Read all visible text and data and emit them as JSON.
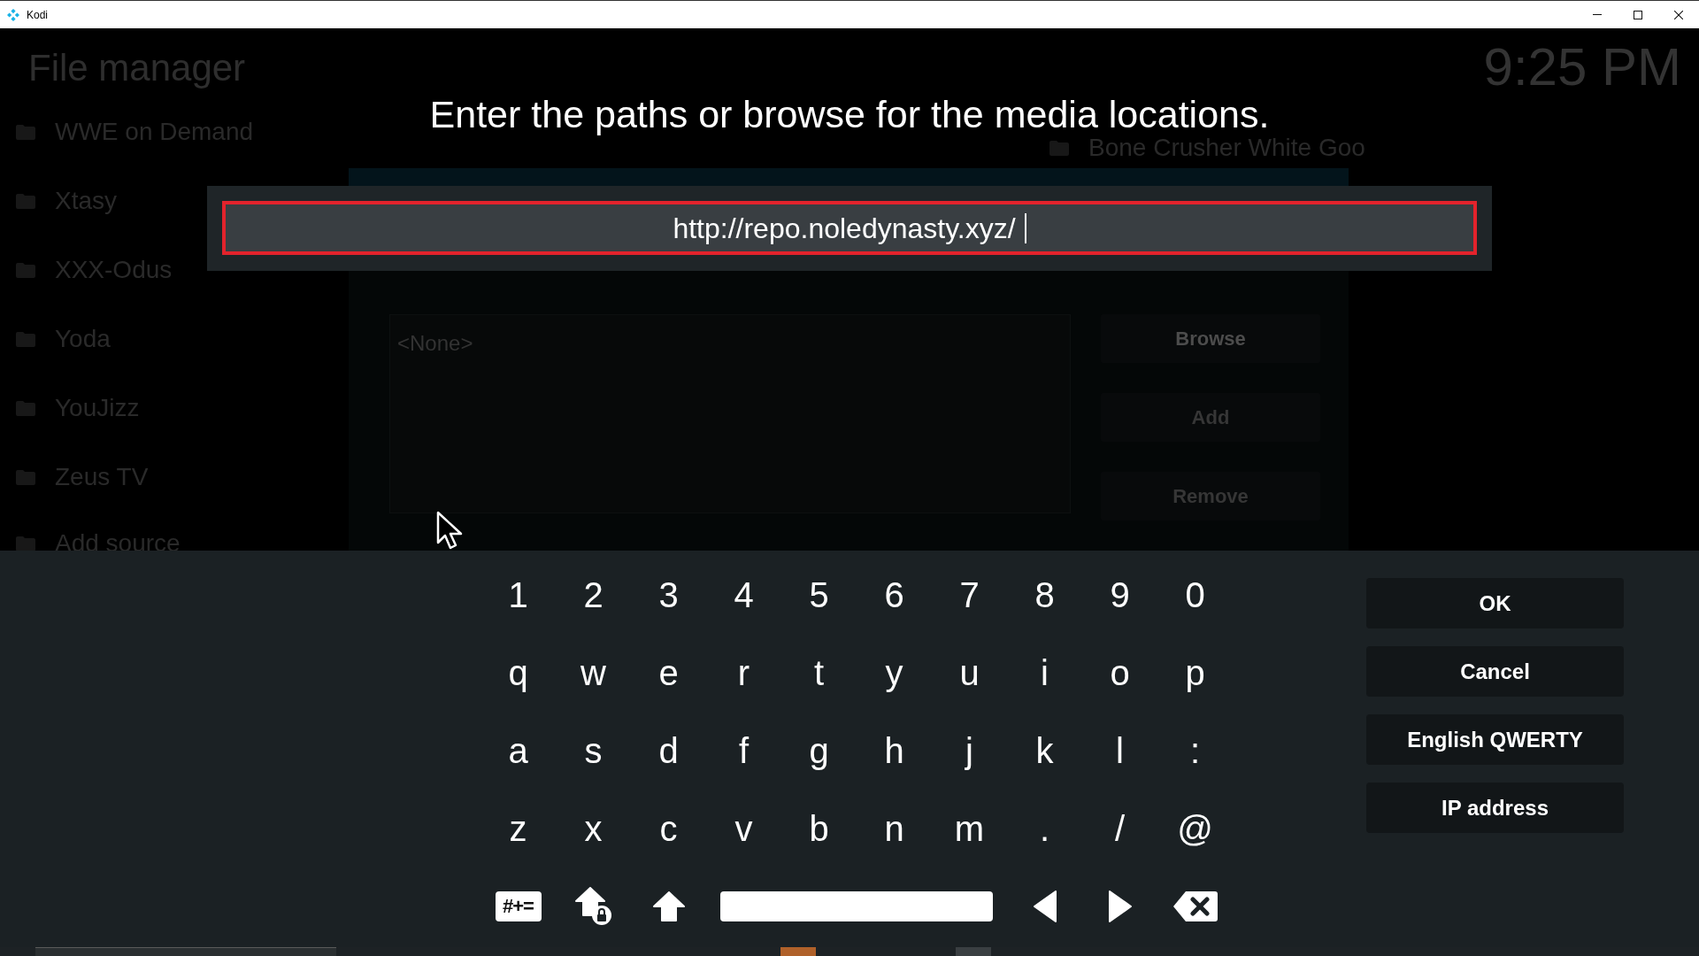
{
  "window": {
    "title": "Kodi"
  },
  "file_manager": {
    "title": "File manager",
    "clock": "9:25 PM",
    "left_sources": [
      {
        "label": "WWE on Demand"
      },
      {
        "label": "Xtasy"
      },
      {
        "label": "XXX-Odus"
      },
      {
        "label": "Yoda"
      },
      {
        "label": "YouJizz"
      },
      {
        "label": "Zeus TV"
      },
      {
        "label": "Add source"
      }
    ],
    "right_sources": [
      {
        "label": "Bone Crusher White Goo"
      }
    ]
  },
  "add_source_dialog": {
    "path_list": {
      "empty_text": "<None>"
    },
    "buttons": [
      {
        "label": "Browse",
        "disabled": false
      },
      {
        "label": "Add",
        "disabled": true
      },
      {
        "label": "Remove",
        "disabled": true
      }
    ]
  },
  "keyboard": {
    "heading": "Enter the paths or browse for the media locations.",
    "input": {
      "value": "http://repo.noledynasty.xyz/"
    },
    "rows": [
      [
        "1",
        "2",
        "3",
        "4",
        "5",
        "6",
        "7",
        "8",
        "9",
        "0"
      ],
      [
        "q",
        "w",
        "e",
        "r",
        "t",
        "y",
        "u",
        "i",
        "o",
        "p"
      ],
      [
        "a",
        "s",
        "d",
        "f",
        "g",
        "h",
        "j",
        "k",
        "l",
        ":"
      ],
      [
        "z",
        "x",
        "c",
        "v",
        "b",
        "n",
        "m",
        ".",
        "/",
        "@"
      ]
    ],
    "special_keys": [
      {
        "kind": "symbols",
        "label": "#+="
      },
      {
        "kind": "caps_lock"
      },
      {
        "kind": "shift"
      },
      {
        "kind": "space"
      },
      {
        "kind": "left"
      },
      {
        "kind": "right"
      },
      {
        "kind": "backspace"
      }
    ],
    "buttons": [
      {
        "label": "OK"
      },
      {
        "label": "Cancel"
      },
      {
        "label": "English QWERTY"
      },
      {
        "label": "IP address"
      }
    ]
  }
}
